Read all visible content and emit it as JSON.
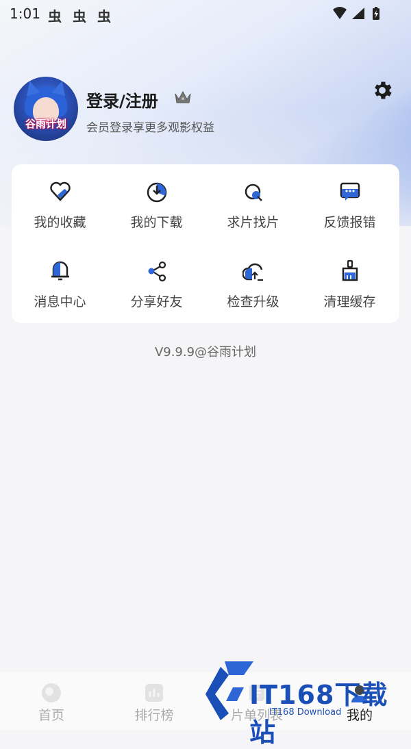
{
  "status_bar": {
    "time": "1:01",
    "notif_glyph": "虫"
  },
  "profile": {
    "avatar_text": "谷雨计划",
    "login_title": "登录/注册",
    "login_subtitle": "会员登录享更多观影权益"
  },
  "grid": [
    {
      "label": "我的收藏",
      "icon": "heart-icon"
    },
    {
      "label": "我的下载",
      "icon": "download-icon"
    },
    {
      "label": "求片找片",
      "icon": "search-film-icon"
    },
    {
      "label": "反馈报错",
      "icon": "feedback-icon"
    },
    {
      "label": "消息中心",
      "icon": "bell-icon"
    },
    {
      "label": "分享好友",
      "icon": "share-icon"
    },
    {
      "label": "检查升级",
      "icon": "upgrade-icon"
    },
    {
      "label": "清理缓存",
      "icon": "broom-icon"
    }
  ],
  "version": "V9.9.9@谷雨计划",
  "tabs": [
    {
      "label": "首页",
      "icon": "home-icon"
    },
    {
      "label": "排行榜",
      "icon": "ranking-icon"
    },
    {
      "label": "片单列表",
      "icon": "list-icon"
    },
    {
      "label": "我的",
      "icon": "profile-icon",
      "active": true
    }
  ],
  "watermark": {
    "big": "IT168下载站",
    "small": "IT168 Download"
  },
  "colors": {
    "accent": "#2f66d6",
    "gradient_end": "#5c86e6"
  }
}
